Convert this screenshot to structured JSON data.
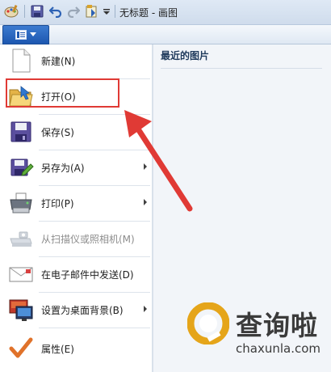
{
  "window": {
    "title": "无标题 - 画图"
  },
  "file_tab": {
    "icon": "file-menu-icon"
  },
  "menu": {
    "items": [
      {
        "label": "新建(N)",
        "icon": "new-document-icon",
        "submenu": false,
        "disabled": false
      },
      {
        "label": "打开(O)",
        "icon": "open-folder-icon",
        "submenu": false,
        "disabled": false
      },
      {
        "label": "保存(S)",
        "icon": "save-disk-icon",
        "submenu": false,
        "disabled": false
      },
      {
        "label": "另存为(A)",
        "icon": "save-as-icon",
        "submenu": true,
        "disabled": false
      },
      {
        "label": "打印(P)",
        "icon": "printer-icon",
        "submenu": true,
        "disabled": false
      },
      {
        "label": "从扫描仪或照相机(M)",
        "icon": "scanner-icon",
        "submenu": false,
        "disabled": true
      },
      {
        "label": "在电子邮件中发送(D)",
        "icon": "email-icon",
        "submenu": false,
        "disabled": false
      },
      {
        "label": "设置为桌面背景(B)",
        "icon": "desktop-background-icon",
        "submenu": true,
        "disabled": false
      },
      {
        "label": "属性(E)",
        "icon": "checkmark-properties-icon",
        "submenu": false,
        "disabled": false
      }
    ]
  },
  "recent": {
    "heading": "最近的图片"
  },
  "watermark": {
    "text_cn": "查询啦",
    "text_en": "chaxunla.com"
  },
  "colors": {
    "highlight": "#e03a35",
    "arrow": "#e03a35",
    "file_tab": "#1d57b0"
  }
}
